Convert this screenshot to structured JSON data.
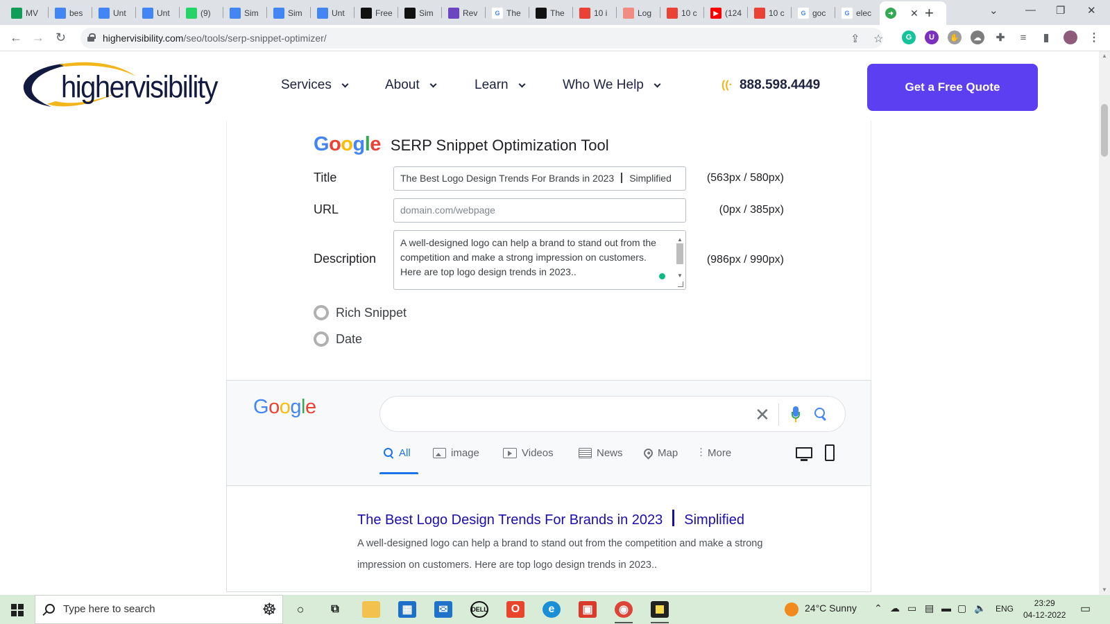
{
  "browser": {
    "tabs": [
      {
        "label": "MV",
        "icon": "sheets-icon",
        "color": "#0f9d58"
      },
      {
        "label": "bes",
        "icon": "docs-icon",
        "color": "#4285f4"
      },
      {
        "label": "Unt",
        "icon": "docs-icon",
        "color": "#4285f4"
      },
      {
        "label": "Unt",
        "icon": "docs-icon",
        "color": "#4285f4"
      },
      {
        "label": "(9)",
        "icon": "whatsapp-icon",
        "color": "#25d366"
      },
      {
        "label": "Sim",
        "icon": "docs-icon",
        "color": "#4285f4"
      },
      {
        "label": "Sim",
        "icon": "docs-icon",
        "color": "#4285f4"
      },
      {
        "label": "Unt",
        "icon": "docs-icon",
        "color": "#4285f4"
      },
      {
        "label": "Free",
        "icon": "bolt-icon",
        "color": "#111111"
      },
      {
        "label": "Sim",
        "icon": "bolt-icon",
        "color": "#111111"
      },
      {
        "label": "Rev",
        "icon": "chatbot-icon",
        "color": "#6b46c1"
      },
      {
        "label": "The",
        "icon": "google-icon",
        "color": "#ffffff"
      },
      {
        "label": "The",
        "icon": "bolt-icon",
        "color": "#111111"
      },
      {
        "label": "10 i",
        "icon": "99d-icon",
        "color": "#ea4335"
      },
      {
        "label": "Log",
        "icon": "99d-icon",
        "color": "#f28b82"
      },
      {
        "label": "10 c",
        "icon": "99d-icon",
        "color": "#ea4335"
      },
      {
        "label": "(124",
        "icon": "youtube-icon",
        "color": "#ff0000"
      },
      {
        "label": "10 c",
        "icon": "99d-icon",
        "color": "#ea4335"
      },
      {
        "label": "goc",
        "icon": "google-icon",
        "color": "#ffffff"
      },
      {
        "label": "elec",
        "icon": "google-icon",
        "color": "#ffffff"
      },
      {
        "label": "",
        "icon": "arrow-icon",
        "color": "#34a853",
        "active": true
      }
    ],
    "url_domain": "highervisibility.com",
    "url_path": "/seo/tools/serp-snippet-optimizer/"
  },
  "site": {
    "logo_text": "highervisibility",
    "nav": [
      {
        "label": "Services"
      },
      {
        "label": "About"
      },
      {
        "label": "Learn"
      },
      {
        "label": "Who We Help"
      }
    ],
    "phone": "888.598.4449",
    "cta_label": "Get a Free Quote"
  },
  "tool": {
    "logo": [
      "G",
      "o",
      "o",
      "g",
      "l",
      "e"
    ],
    "heading": "SERP Snippet Optimization Tool",
    "fields": {
      "title_label": "Title",
      "title_value_main": "The Best Logo Design Trends For Brands in 2023",
      "title_value_suffix": "Simplified",
      "title_count": "(563px / 580px)",
      "url_label": "URL",
      "url_placeholder": "domain.com/webpage",
      "url_count": "(0px / 385px)",
      "description_label": "Description",
      "description_value": " A well-designed logo can help a brand to stand out from the competition and make a strong impression on customers. Here are top logo design trends in 2023..",
      "description_count": "(986px / 990px)"
    },
    "options": [
      {
        "label": "Rich Snippet",
        "checked": false
      },
      {
        "label": "Date",
        "checked": false
      }
    ]
  },
  "serp": {
    "logo": [
      "G",
      "o",
      "o",
      "g",
      "l",
      "e"
    ],
    "tabs": [
      {
        "label": "All",
        "icon": "search-icon",
        "active": true
      },
      {
        "label": "image",
        "icon": "image-icon"
      },
      {
        "label": "Videos",
        "icon": "video-icon"
      },
      {
        "label": "News",
        "icon": "news-icon"
      },
      {
        "label": "Map",
        "icon": "map-pin-icon"
      },
      {
        "label": "More",
        "icon": "more-dots-icon"
      }
    ],
    "result": {
      "title_main": "The Best Logo Design Trends For Brands in 2023",
      "title_suffix": "Simplified",
      "description": "A well-designed logo can help a brand to stand out from the competition and make a strong impression on customers. Here are top logo design trends in 2023.."
    }
  },
  "taskbar": {
    "search_placeholder": "Type here to search",
    "weather": "24°C  Sunny",
    "language": "ENG",
    "time": "23:29",
    "date": "04-12-2022"
  },
  "colors": {
    "brand_purple": "#5b3ff1",
    "brand_navy": "#131a40",
    "link_blue": "#1a0dab",
    "google_blue": "#4285f4",
    "google_red": "#ea4335",
    "google_yellow": "#fbbc05",
    "google_green": "#34a853"
  }
}
